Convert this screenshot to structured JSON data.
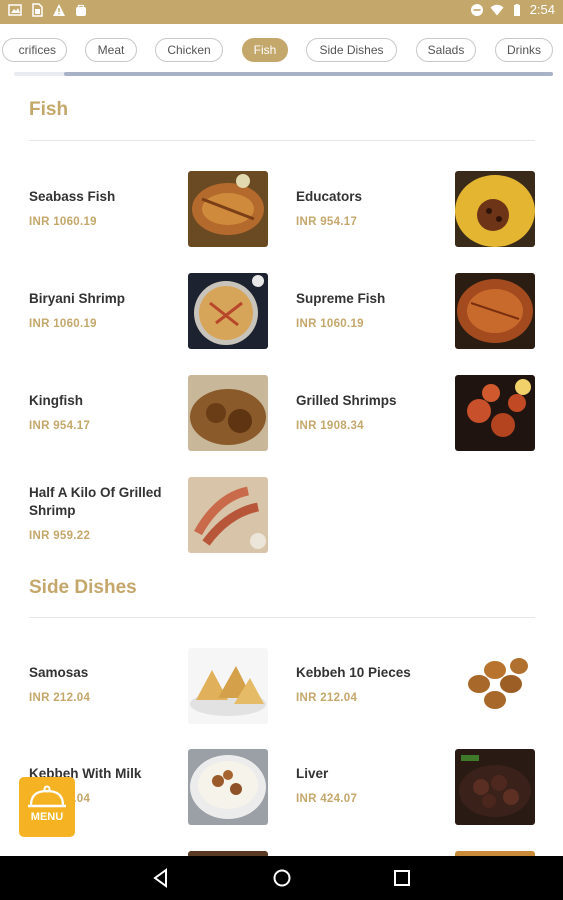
{
  "status_bar": {
    "time": "2:54",
    "left_icons": [
      "image-icon",
      "sim-icon",
      "warning-icon",
      "bag-icon"
    ],
    "right_icons": [
      "do-not-disturb-icon",
      "wifi-icon",
      "battery-icon"
    ]
  },
  "categories": [
    {
      "label": "crifices",
      "active": false
    },
    {
      "label": "Meat",
      "active": false
    },
    {
      "label": "Chicken",
      "active": false
    },
    {
      "label": "Fish",
      "active": true
    },
    {
      "label": "Side Dishes",
      "active": false
    },
    {
      "label": "Salads",
      "active": false
    },
    {
      "label": "Drinks",
      "active": false
    }
  ],
  "sections": [
    {
      "title": "Fish",
      "items": [
        {
          "name": "Seabass Fish",
          "price": "INR 1060.19"
        },
        {
          "name": "Educators",
          "price": "INR 954.17"
        },
        {
          "name": "Biryani Shrimp",
          "price": "INR 1060.19"
        },
        {
          "name": "Supreme Fish",
          "price": "INR 1060.19"
        },
        {
          "name": "Kingfish",
          "price": "INR 954.17"
        },
        {
          "name": "Grilled Shrimps",
          "price": "INR 1908.34"
        },
        {
          "name": "Half A Kilo Of Grilled Shrimp",
          "price": "INR 959.22"
        }
      ]
    },
    {
      "title": "Side Dishes",
      "items": [
        {
          "name": "Samosas",
          "price": "INR 212.04"
        },
        {
          "name": "Kebbeh 10 Pieces",
          "price": "INR 212.04"
        },
        {
          "name": "Kebbeh With Milk",
          "price": "INR 212.04"
        },
        {
          "name": "Liver",
          "price": "INR 424.07"
        }
      ]
    }
  ],
  "menu_button": {
    "label": "MENU",
    "icon": "cloche-icon"
  },
  "nav_bar": {
    "buttons": [
      "back-icon",
      "home-icon",
      "recents-icon"
    ]
  },
  "colors": {
    "accent": "#c4a76b",
    "fab": "#f5b323",
    "text": "#333333"
  }
}
